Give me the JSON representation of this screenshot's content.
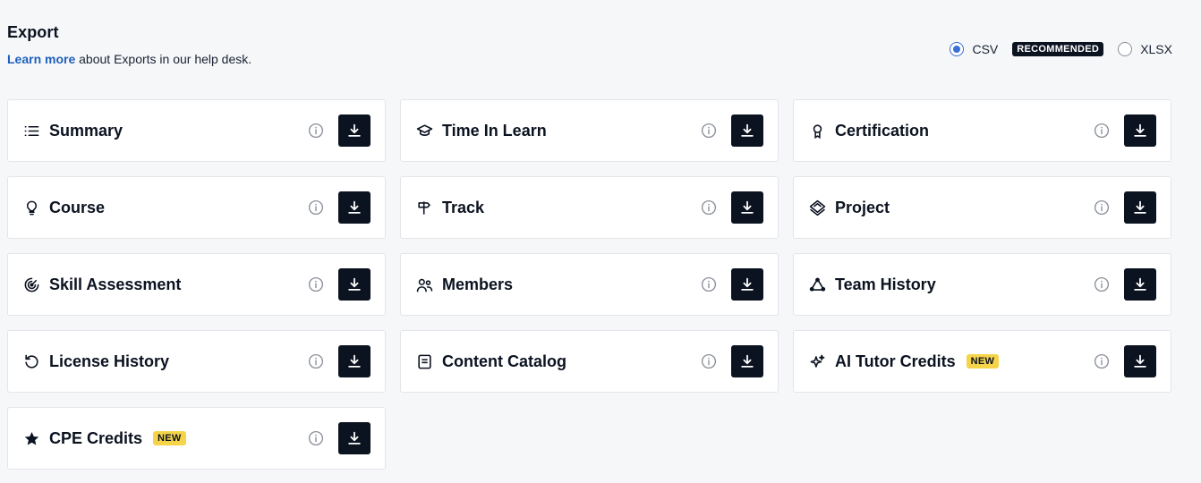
{
  "header": {
    "title": "Export",
    "learn_more": "Learn more",
    "subtitle_rest": " about Exports in our help desk."
  },
  "format": {
    "csv_label": "CSV",
    "recommended_badge": "RECOMMENDED",
    "xlsx_label": "XLSX",
    "selected": "CSV"
  },
  "cards": [
    {
      "label": "Summary",
      "icon": "list-icon",
      "badge": ""
    },
    {
      "label": "Time In Learn",
      "icon": "graduation-cap-icon",
      "badge": ""
    },
    {
      "label": "Certification",
      "icon": "award-icon",
      "badge": ""
    },
    {
      "label": "Course",
      "icon": "lightbulb-icon",
      "badge": ""
    },
    {
      "label": "Track",
      "icon": "signpost-icon",
      "badge": ""
    },
    {
      "label": "Project",
      "icon": "layers-icon",
      "badge": ""
    },
    {
      "label": "Skill Assessment",
      "icon": "radar-icon",
      "badge": ""
    },
    {
      "label": "Members",
      "icon": "users-icon",
      "badge": ""
    },
    {
      "label": "Team History",
      "icon": "team-triangle-icon",
      "badge": ""
    },
    {
      "label": "License History",
      "icon": "history-icon",
      "badge": ""
    },
    {
      "label": "Content Catalog",
      "icon": "catalog-icon",
      "badge": ""
    },
    {
      "label": "AI Tutor Credits",
      "icon": "sparkles-icon",
      "badge": "NEW"
    },
    {
      "label": "CPE Credits",
      "icon": "star-icon",
      "badge": "NEW"
    }
  ],
  "colors": {
    "accent": "#1f5fb9",
    "dark": "#0b1220",
    "new_badge": "#f5d44a"
  }
}
